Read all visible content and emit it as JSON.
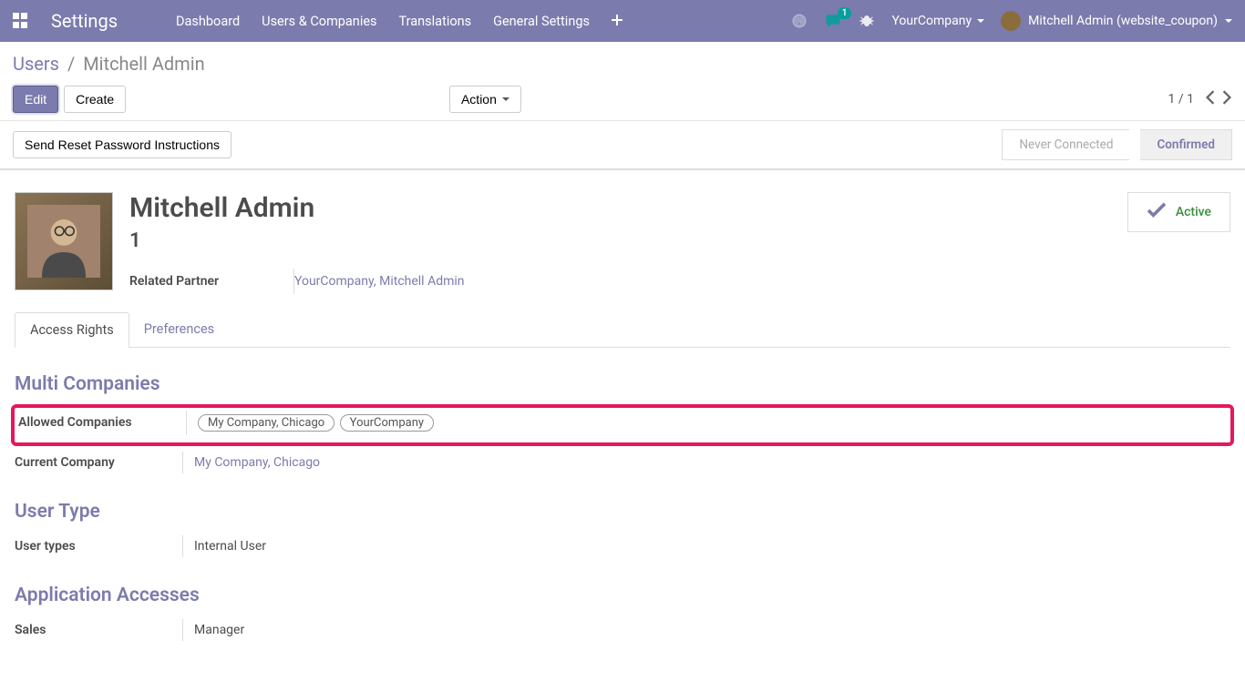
{
  "topnav": {
    "app_title": "Settings",
    "links": [
      "Dashboard",
      "Users & Companies",
      "Translations",
      "General Settings"
    ],
    "msg_badge": "1",
    "company": "YourCompany",
    "user": "Mitchell Admin (website_coupon)"
  },
  "breadcrumb": {
    "parent": "Users",
    "current": "Mitchell Admin"
  },
  "toolbar": {
    "edit": "Edit",
    "create": "Create",
    "action": "Action",
    "pager": "1 / 1"
  },
  "subtoolbar": {
    "reset_pw": "Send Reset Password Instructions",
    "status_inactive": "Never Connected",
    "status_active": "Confirmed"
  },
  "user": {
    "name": "Mitchell Admin",
    "login": "1",
    "related_partner_label": "Related Partner",
    "related_partner_value": "YourCompany, Mitchell Admin",
    "active_label": "Active"
  },
  "tabs": {
    "access_rights": "Access Rights",
    "preferences": "Preferences"
  },
  "sections": {
    "multi_companies": {
      "title": "Multi Companies",
      "allowed_label": "Allowed Companies",
      "allowed_tags": [
        "My Company, Chicago",
        "YourCompany"
      ],
      "current_label": "Current Company",
      "current_value": "My Company, Chicago"
    },
    "user_type": {
      "title": "User Type",
      "label": "User types",
      "value": "Internal User"
    },
    "app_access": {
      "title": "Application Accesses",
      "sales_label": "Sales",
      "sales_value": "Manager"
    }
  }
}
